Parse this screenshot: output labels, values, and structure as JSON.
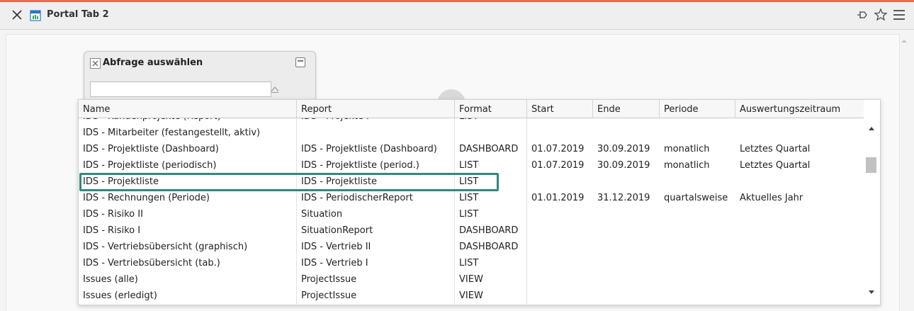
{
  "window": {
    "title": "Portal Tab 2"
  },
  "query_panel": {
    "title": "Abfrage auswählen",
    "input_value": ""
  },
  "table": {
    "columns": [
      "Name",
      "Report",
      "Format",
      "Start",
      "Ende",
      "Periode",
      "Auswertungszeitraum"
    ],
    "rows": [
      [
        "IDS - Kundenprojekte (Report)",
        "IDS - Projekte I",
        "LIST",
        "",
        "",
        "",
        ""
      ],
      [
        "IDS - Mitarbeiter (festangestellt, aktiv)",
        "",
        "",
        "",
        "",
        "",
        ""
      ],
      [
        "IDS - Projektliste (Dashboard)",
        "IDS - Projektliste (Dashboard)",
        "DASHBOARD",
        "01.07.2019",
        "30.09.2019",
        "monatlich",
        "Letztes Quartal"
      ],
      [
        "IDS - Projektliste (periodisch)",
        "IDS - Projektliste (period.)",
        "LIST",
        "01.07.2019",
        "30.09.2019",
        "monatlich",
        "Letztes Quartal"
      ],
      [
        "IDS - Projektliste",
        "IDS - Projektliste",
        "LIST",
        "",
        "",
        "",
        ""
      ],
      [
        "IDS - Rechnungen (Periode)",
        "IDS - PeriodischerReport",
        "LIST",
        "01.01.2019",
        "31.12.2019",
        "quartalsweise",
        "Aktuelles Jahr"
      ],
      [
        "IDS - Risiko II",
        "Situation",
        "LIST",
        "",
        "",
        "",
        ""
      ],
      [
        "IDS - Risiko I",
        "SituationReport",
        "DASHBOARD",
        "",
        "",
        "",
        ""
      ],
      [
        "IDS - Vertriebsübersicht (graphisch)",
        "IDS - Vertrieb II",
        "DASHBOARD",
        "",
        "",
        "",
        ""
      ],
      [
        "IDS - Vertriebsübersicht (tab.)",
        "IDS - Vertrieb I",
        "LIST",
        "",
        "",
        "",
        ""
      ],
      [
        "Issues (alle)",
        "ProjectIssue",
        "VIEW",
        "",
        "",
        "",
        ""
      ],
      [
        "Issues (erledigt)",
        "ProjectIssue",
        "VIEW",
        "",
        "",
        "",
        ""
      ]
    ],
    "highlighted_row": 4
  },
  "colors": {
    "accent": "#e07050",
    "highlight": "#2f8a7c",
    "scroll_thumb": "#c1c1c1"
  },
  "icons": [
    "close-icon",
    "tab-icon",
    "pin-icon",
    "star-icon",
    "menu-icon",
    "scroll-up-icon",
    "scroll-down-icon",
    "minimize-icon"
  ]
}
